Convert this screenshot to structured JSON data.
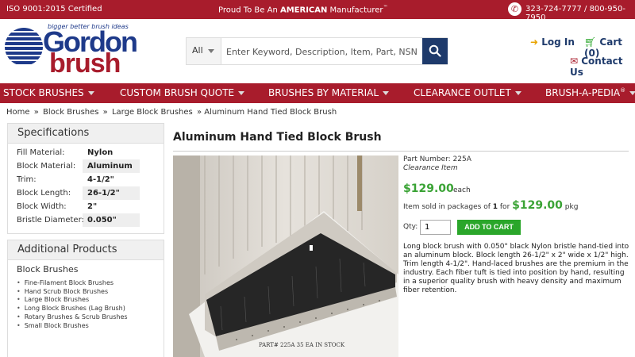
{
  "topbar": {
    "iso": "ISO 9001:2015 Certified",
    "proud_pre": "Proud To Be An ",
    "proud_bold": "AMERICAN",
    "proud_post": " Manufacturer",
    "proud_tm": "™",
    "phones": "323-724-7777 / 800-950-7950"
  },
  "logo": {
    "tagline": "bigger better brush ideas",
    "word1": "Gordon",
    "word2": "brush"
  },
  "search": {
    "category": "All",
    "placeholder": "Enter Keyword, Description, Item, Part, NSN"
  },
  "account": {
    "login": "Log In",
    "cart": "Cart (0)",
    "contact": "Contact Us"
  },
  "nav": {
    "items": [
      "STOCK BRUSHES",
      "CUSTOM BRUSH QUOTE",
      "BRUSHES BY MATERIAL",
      "CLEARANCE OUTLET",
      "BRUSH-A-PEDIA"
    ],
    "reg": "®"
  },
  "breadcrumb": {
    "home": "Home",
    "sep": "»",
    "block": "Block Brushes",
    "large": "Large Block Brushes",
    "current": "» Aluminum Hand Tied Block Brush"
  },
  "specs": {
    "title": "Specifications",
    "rows": [
      {
        "k": "Fill Material:",
        "v": "Nylon"
      },
      {
        "k": "Block Material:",
        "v": "Aluminum"
      },
      {
        "k": "Trim:",
        "v": "4-1/2\""
      },
      {
        "k": "Block Length:",
        "v": "26-1/2\""
      },
      {
        "k": "Block Width:",
        "v": "2\""
      },
      {
        "k": "Bristle Diameter:",
        "v": "0.050\""
      }
    ]
  },
  "additional": {
    "title": "Additional Products",
    "subtitle": "Block Brushes",
    "items": [
      "Fine-Filament Block Brushes",
      "Hand Scrub Block Brushes",
      "Large Block Brushes",
      "Long Block Brushes (Lag Brush)",
      "Rotary Brushes & Scrub Brushes",
      "Small Block Brushes"
    ]
  },
  "product": {
    "title": "Aluminum Hand Tied Block Brush",
    "part_number": "Part Number: 225A",
    "status": "Clearance Item",
    "price": "$129.00",
    "each": "each",
    "pkg_pre": "Item sold in packages of ",
    "pkg_count": "1",
    "pkg_for": " for ",
    "pkg_price": "$129.00",
    "pkg_unit": " pkg",
    "qty_label": "Qty:",
    "qty_value": "1",
    "add_to_cart": "ADD TO CART",
    "photo_caption": "PART# 225A  35 EA IN STOCK",
    "description": "Long block brush with 0.050\" black Nylon bristle hand-tied into an aluminum block. Block length 26-1/2\" x 2\" wide x 1/2\" high. Trim length 4-1/2\". Hand-laced brushes are the premium in the industry. Each fiber tuft is tied into position by hand, resulting in a superior quality brush with heavy density and maximum fiber retention."
  },
  "colors": {
    "brand_red": "#a81c2c",
    "brand_blue": "#1e3a8a",
    "price_green": "#3aa335",
    "cart_green": "#2aa62a"
  }
}
